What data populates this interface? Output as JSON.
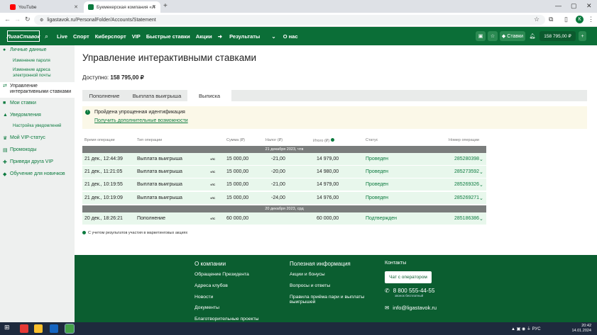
{
  "browser": {
    "tabs": [
      {
        "title": "YouTube",
        "color": "#ff0000"
      },
      {
        "title": "Букмекерская компания «Ли",
        "color": "#0b7a3e"
      }
    ],
    "url": "ligastavok.ru/PersonalFolder/Accounts/Statement",
    "avatar_letter": "К"
  },
  "header": {
    "logo": "ЛигаСтавок",
    "nav": [
      "Live",
      "Спорт",
      "Киберспорт",
      "VIP",
      "Быстрые ставки",
      "Акции",
      "Результаты",
      "О нас"
    ],
    "bets_label": "Ставки",
    "balance": "158 795,00 ₽"
  },
  "sidebar": {
    "items": [
      {
        "label": "Личные данные",
        "type": "main",
        "icon": "user-icon"
      },
      {
        "label": "Изменение пароля",
        "type": "sub"
      },
      {
        "label": "Изменение адреса электронной почты",
        "type": "sub"
      },
      {
        "label": "Управление интерактивными ставками",
        "type": "active",
        "icon": "arrows-icon"
      },
      {
        "label": "Мои ставки",
        "type": "main",
        "icon": "ticket-icon"
      },
      {
        "label": "Уведомления",
        "type": "main",
        "icon": "bell-icon"
      },
      {
        "label": "Настройка уведомлений",
        "type": "sub"
      },
      {
        "label": "Мой VIP-статус",
        "type": "main",
        "icon": "crown-icon"
      },
      {
        "label": "Промокоды",
        "type": "main",
        "icon": "promo-icon"
      },
      {
        "label": "Приведи друга VIP",
        "type": "main",
        "icon": "gift-icon"
      },
      {
        "label": "Обучение для новичков",
        "type": "main",
        "icon": "cap-icon"
      }
    ]
  },
  "page": {
    "title": "Управление интерактивными ставками",
    "available_label": "Доступно:",
    "available_value": "158 795,00 ₽",
    "tabs": [
      "Пополнение",
      "Выплата выигрыша",
      "Выписка"
    ],
    "notice_text": "Пройдена упрощенная идентификация",
    "notice_link": "Получить дополнительные возможности",
    "table": {
      "headers": [
        "Время операции",
        "Тип операции",
        "Сумма (₽)",
        "Налог (₽)",
        "Итого (₽)",
        "Статус",
        "Номер операции"
      ],
      "groups": [
        {
          "date": "21 декабря 2023, чтв",
          "rows": [
            {
              "time": "21 дек., 12:44:39",
              "type": "Выплата выигрыша",
              "sum": "15 000,00",
              "tax": "-21,00",
              "total": "14 979,00",
              "status": "Проведен",
              "num": "285280398"
            },
            {
              "time": "21 дек., 11:21:05",
              "type": "Выплата выигрыша",
              "sum": "15 000,00",
              "tax": "-20,00",
              "total": "14 980,00",
              "status": "Проведен",
              "num": "285273592"
            },
            {
              "time": "21 дек., 10:19:55",
              "type": "Выплата выигрыша",
              "sum": "15 000,00",
              "tax": "-21,00",
              "total": "14 979,00",
              "status": "Проведен",
              "num": "285269326"
            },
            {
              "time": "21 дек., 10:19:09",
              "type": "Выплата выигрыша",
              "sum": "15 000,00",
              "tax": "-24,00",
              "total": "14 976,00",
              "status": "Проведен",
              "num": "285269271"
            }
          ]
        },
        {
          "date": "20 декабря 2023, срд",
          "rows": [
            {
              "time": "20 дек., 18:26:21",
              "type": "Пополнение",
              "sum": "60 000,00",
              "tax": "",
              "total": "60 000,00",
              "status": "Подтвержден",
              "num": "285186386"
            }
          ]
        }
      ]
    },
    "footnote": "С учетом результатов участия в маркетинговых акциях"
  },
  "footer": {
    "about_title": "О компании",
    "about_items": [
      "Обращение Президента",
      "Адреса клубов",
      "Новости",
      "Документы",
      "Благотворительные проекты"
    ],
    "info_title": "Полезная информация",
    "info_items": [
      "Акции и бонусы",
      "Вопросы и ответы",
      "Правила приёма пари и выплаты выигрышей"
    ],
    "contacts_title": "Контакты",
    "chat_button": "Чат с оператором",
    "phone": "8 800 555-44-55",
    "phone_note": "звонок бесплатный",
    "email": "info@ligastavok.ru"
  },
  "taskbar": {
    "time": "20:42",
    "date": "14.01.2024",
    "lang": "РУС"
  }
}
